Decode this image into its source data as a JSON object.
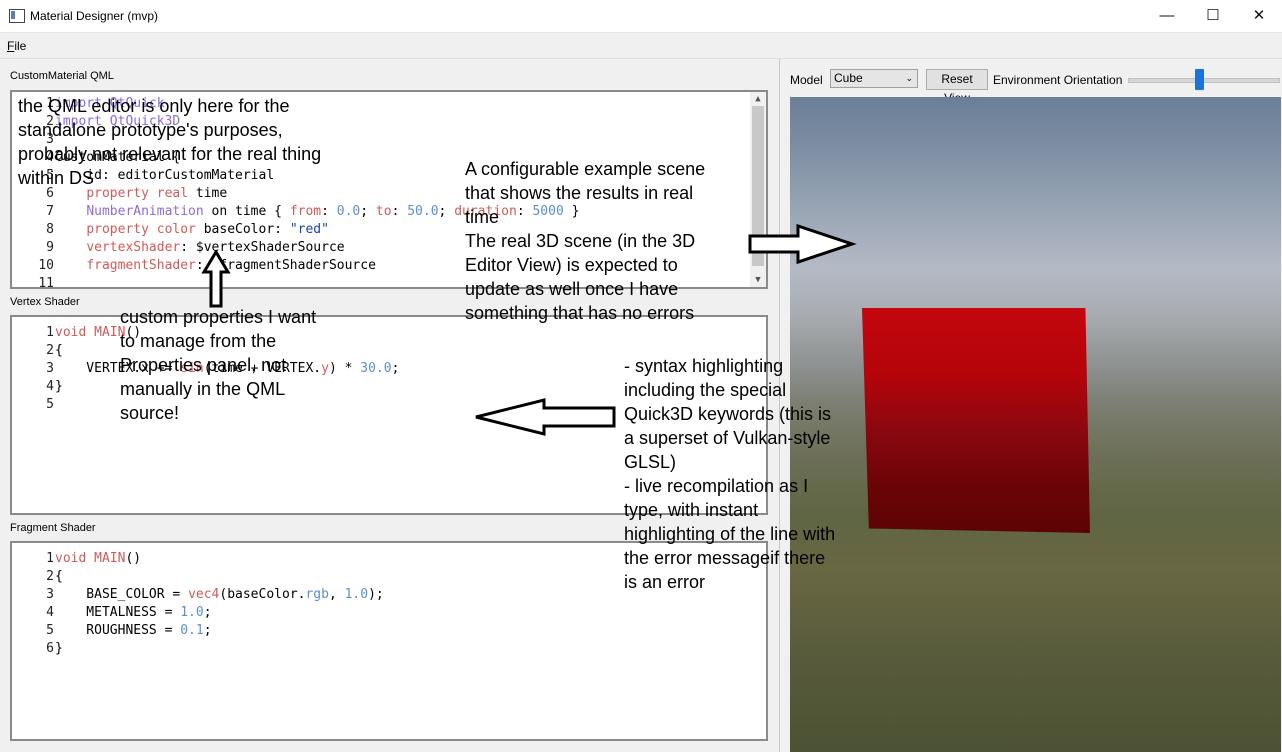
{
  "window": {
    "title": "Material Designer (mvp)",
    "minimize": "—",
    "maximize": "☐",
    "close": "✕"
  },
  "menu": {
    "file_first": "F",
    "file_rest": "ile"
  },
  "qml_section": {
    "label": "CustomMaterial QML",
    "lines": [
      {
        "n": "1",
        "parts": [
          {
            "t": "import QtQuick",
            "c": "kw-pur"
          }
        ]
      },
      {
        "n": "2",
        "parts": [
          {
            "t": "import QtQuick3D",
            "c": "kw-pur"
          }
        ]
      },
      {
        "n": "3",
        "parts": [
          {
            "t": "",
            "c": ""
          }
        ]
      },
      {
        "n": "4",
        "parts": [
          {
            "t": "CustomMaterial {",
            "c": ""
          }
        ]
      },
      {
        "n": "5",
        "parts": [
          {
            "t": "    id: editorCustomMaterial",
            "c": ""
          }
        ]
      },
      {
        "n": "6",
        "parts": [
          {
            "t": "    ",
            "c": ""
          },
          {
            "t": "property real",
            "c": "kw-red"
          },
          {
            "t": " time",
            "c": ""
          }
        ]
      },
      {
        "n": "7",
        "parts": [
          {
            "t": "    ",
            "c": ""
          },
          {
            "t": "NumberAnimation",
            "c": "kw-pur"
          },
          {
            "t": " on time { ",
            "c": ""
          },
          {
            "t": "from",
            "c": "kw-red"
          },
          {
            "t": ": ",
            "c": ""
          },
          {
            "t": "0.0",
            "c": "kw-blue"
          },
          {
            "t": "; ",
            "c": ""
          },
          {
            "t": "to",
            "c": "kw-red"
          },
          {
            "t": ": ",
            "c": ""
          },
          {
            "t": "50.0",
            "c": "kw-blue"
          },
          {
            "t": "; ",
            "c": ""
          },
          {
            "t": "duration",
            "c": "kw-red"
          },
          {
            "t": ": ",
            "c": ""
          },
          {
            "t": "5000",
            "c": "kw-blue"
          },
          {
            "t": " }",
            "c": ""
          }
        ]
      },
      {
        "n": "8",
        "parts": [
          {
            "t": "    ",
            "c": ""
          },
          {
            "t": "property color",
            "c": "kw-red"
          },
          {
            "t": " baseColor: ",
            "c": ""
          },
          {
            "t": "\"red\"",
            "c": "kw-str"
          }
        ]
      },
      {
        "n": "9",
        "parts": [
          {
            "t": "    ",
            "c": ""
          },
          {
            "t": "vertexShader",
            "c": "kw-red"
          },
          {
            "t": ": $vertexShaderSource",
            "c": ""
          }
        ]
      },
      {
        "n": "10",
        "parts": [
          {
            "t": "    ",
            "c": ""
          },
          {
            "t": "fragmentShader",
            "c": "kw-red"
          },
          {
            "t": ": $fragmentShaderSource",
            "c": ""
          }
        ]
      },
      {
        "n": "11",
        "parts": [
          {
            "t": "",
            "c": ""
          }
        ]
      }
    ]
  },
  "vertex_section": {
    "label": "Vertex Shader",
    "lines": [
      {
        "n": "1",
        "parts": [
          {
            "t": "void MAIN",
            "c": "kw-red"
          },
          {
            "t": "()",
            "c": ""
          }
        ]
      },
      {
        "n": "2",
        "parts": [
          {
            "t": "{",
            "c": ""
          }
        ]
      },
      {
        "n": "3",
        "parts": [
          {
            "t": "    VERTEX.x += ",
            "c": ""
          },
          {
            "t": "sin",
            "c": "kw-red"
          },
          {
            "t": "(time + VERTEX.",
            "c": ""
          },
          {
            "t": "y",
            "c": "kw-red"
          },
          {
            "t": ") * ",
            "c": ""
          },
          {
            "t": "30.0",
            "c": "kw-blue"
          },
          {
            "t": ";",
            "c": ""
          }
        ]
      },
      {
        "n": "4",
        "parts": [
          {
            "t": "}",
            "c": ""
          }
        ]
      },
      {
        "n": "5",
        "parts": [
          {
            "t": "",
            "c": ""
          }
        ]
      }
    ]
  },
  "fragment_section": {
    "label": "Fragment Shader",
    "lines": [
      {
        "n": "1",
        "parts": [
          {
            "t": "void MAIN",
            "c": "kw-red"
          },
          {
            "t": "()",
            "c": ""
          }
        ]
      },
      {
        "n": "2",
        "parts": [
          {
            "t": "{",
            "c": ""
          }
        ]
      },
      {
        "n": "3",
        "parts": [
          {
            "t": "    BASE_COLOR = ",
            "c": ""
          },
          {
            "t": "vec4",
            "c": "kw-red"
          },
          {
            "t": "(baseColor.",
            "c": ""
          },
          {
            "t": "rgb",
            "c": "kw-blue"
          },
          {
            "t": ", ",
            "c": ""
          },
          {
            "t": "1.0",
            "c": "kw-blue"
          },
          {
            "t": ");",
            "c": ""
          }
        ]
      },
      {
        "n": "4",
        "parts": [
          {
            "t": "    METALNESS = ",
            "c": ""
          },
          {
            "t": "1.0",
            "c": "kw-blue"
          },
          {
            "t": ";",
            "c": ""
          }
        ]
      },
      {
        "n": "5",
        "parts": [
          {
            "t": "    ROUGHNESS = ",
            "c": ""
          },
          {
            "t": "0.1",
            "c": "kw-blue"
          },
          {
            "t": ";",
            "c": ""
          }
        ]
      },
      {
        "n": "6",
        "parts": [
          {
            "t": "}",
            "c": ""
          }
        ]
      }
    ]
  },
  "toolbar": {
    "model_label": "Model",
    "model_value": "Cube",
    "reset_label": "Reset View",
    "env_label": "Environment Orientation",
    "env_slider_fraction": 0.47
  },
  "annotations": {
    "qml_note": "the QML editor is only here for the\nstandalone prototype's purposes,\nprobably not relevant for the real thing\nwithin DS",
    "props_note": "custom properties I want\nto manage from the\nProperties panel, not\nmanually in the QML\nsource!",
    "scene_note": "A configurable example scene\nthat shows the results in real\ntime\nThe real 3D scene (in the 3D\nEditor View) is expected to\nupdate as well once I have\nsomething that has no errors",
    "syntax_note": "- syntax highlighting\nincluding the special\nQuick3D keywords (this is\na superset of Vulkan-style\nGLSL)\n- live recompilation as I\ntype, with instant\nhighlighting of the line with\nthe error messageif there\nis an error"
  },
  "colors": {
    "accent": "#1a73d8",
    "cube_red": "#c4060e"
  }
}
